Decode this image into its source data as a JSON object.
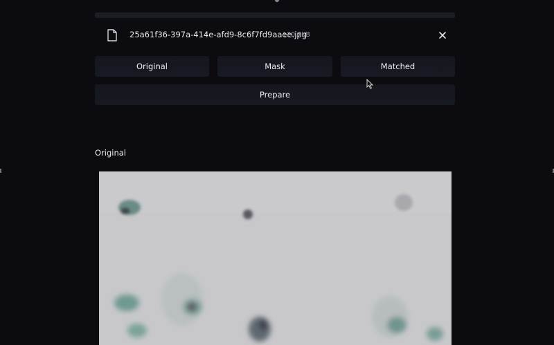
{
  "file": {
    "name": "25a61f36-397a-414e-afd9-8c6f7fd9aaee.jpg",
    "size": "120.7KB",
    "icon": "file-icon",
    "close_icon": "close-icon"
  },
  "view_buttons": [
    {
      "label": "Original"
    },
    {
      "label": "Mask"
    },
    {
      "label": "Matched"
    }
  ],
  "prepare_button": {
    "label": "Prepare"
  },
  "section": {
    "title": "Original"
  },
  "colors": {
    "background": "#0b0b10",
    "button": "#171922",
    "image_bg": "#c9c9cc",
    "cell_teal": "#5f8f86",
    "cell_dark": "#3e3a48"
  }
}
